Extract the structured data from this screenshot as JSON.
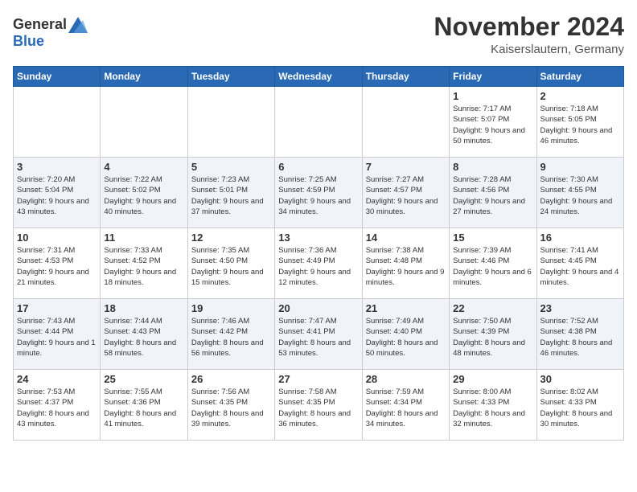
{
  "logo": {
    "general": "General",
    "blue": "Blue"
  },
  "title": "November 2024",
  "location": "Kaiserslautern, Germany",
  "weekdays": [
    "Sunday",
    "Monday",
    "Tuesday",
    "Wednesday",
    "Thursday",
    "Friday",
    "Saturday"
  ],
  "weeks": [
    [
      {
        "day": "",
        "sunrise": "",
        "sunset": "",
        "daylight": ""
      },
      {
        "day": "",
        "sunrise": "",
        "sunset": "",
        "daylight": ""
      },
      {
        "day": "",
        "sunrise": "",
        "sunset": "",
        "daylight": ""
      },
      {
        "day": "",
        "sunrise": "",
        "sunset": "",
        "daylight": ""
      },
      {
        "day": "",
        "sunrise": "",
        "sunset": "",
        "daylight": ""
      },
      {
        "day": "1",
        "sunrise": "Sunrise: 7:17 AM",
        "sunset": "Sunset: 5:07 PM",
        "daylight": "Daylight: 9 hours and 50 minutes."
      },
      {
        "day": "2",
        "sunrise": "Sunrise: 7:18 AM",
        "sunset": "Sunset: 5:05 PM",
        "daylight": "Daylight: 9 hours and 46 minutes."
      }
    ],
    [
      {
        "day": "3",
        "sunrise": "Sunrise: 7:20 AM",
        "sunset": "Sunset: 5:04 PM",
        "daylight": "Daylight: 9 hours and 43 minutes."
      },
      {
        "day": "4",
        "sunrise": "Sunrise: 7:22 AM",
        "sunset": "Sunset: 5:02 PM",
        "daylight": "Daylight: 9 hours and 40 minutes."
      },
      {
        "day": "5",
        "sunrise": "Sunrise: 7:23 AM",
        "sunset": "Sunset: 5:01 PM",
        "daylight": "Daylight: 9 hours and 37 minutes."
      },
      {
        "day": "6",
        "sunrise": "Sunrise: 7:25 AM",
        "sunset": "Sunset: 4:59 PM",
        "daylight": "Daylight: 9 hours and 34 minutes."
      },
      {
        "day": "7",
        "sunrise": "Sunrise: 7:27 AM",
        "sunset": "Sunset: 4:57 PM",
        "daylight": "Daylight: 9 hours and 30 minutes."
      },
      {
        "day": "8",
        "sunrise": "Sunrise: 7:28 AM",
        "sunset": "Sunset: 4:56 PM",
        "daylight": "Daylight: 9 hours and 27 minutes."
      },
      {
        "day": "9",
        "sunrise": "Sunrise: 7:30 AM",
        "sunset": "Sunset: 4:55 PM",
        "daylight": "Daylight: 9 hours and 24 minutes."
      }
    ],
    [
      {
        "day": "10",
        "sunrise": "Sunrise: 7:31 AM",
        "sunset": "Sunset: 4:53 PM",
        "daylight": "Daylight: 9 hours and 21 minutes."
      },
      {
        "day": "11",
        "sunrise": "Sunrise: 7:33 AM",
        "sunset": "Sunset: 4:52 PM",
        "daylight": "Daylight: 9 hours and 18 minutes."
      },
      {
        "day": "12",
        "sunrise": "Sunrise: 7:35 AM",
        "sunset": "Sunset: 4:50 PM",
        "daylight": "Daylight: 9 hours and 15 minutes."
      },
      {
        "day": "13",
        "sunrise": "Sunrise: 7:36 AM",
        "sunset": "Sunset: 4:49 PM",
        "daylight": "Daylight: 9 hours and 12 minutes."
      },
      {
        "day": "14",
        "sunrise": "Sunrise: 7:38 AM",
        "sunset": "Sunset: 4:48 PM",
        "daylight": "Daylight: 9 hours and 9 minutes."
      },
      {
        "day": "15",
        "sunrise": "Sunrise: 7:39 AM",
        "sunset": "Sunset: 4:46 PM",
        "daylight": "Daylight: 9 hours and 6 minutes."
      },
      {
        "day": "16",
        "sunrise": "Sunrise: 7:41 AM",
        "sunset": "Sunset: 4:45 PM",
        "daylight": "Daylight: 9 hours and 4 minutes."
      }
    ],
    [
      {
        "day": "17",
        "sunrise": "Sunrise: 7:43 AM",
        "sunset": "Sunset: 4:44 PM",
        "daylight": "Daylight: 9 hours and 1 minute."
      },
      {
        "day": "18",
        "sunrise": "Sunrise: 7:44 AM",
        "sunset": "Sunset: 4:43 PM",
        "daylight": "Daylight: 8 hours and 58 minutes."
      },
      {
        "day": "19",
        "sunrise": "Sunrise: 7:46 AM",
        "sunset": "Sunset: 4:42 PM",
        "daylight": "Daylight: 8 hours and 56 minutes."
      },
      {
        "day": "20",
        "sunrise": "Sunrise: 7:47 AM",
        "sunset": "Sunset: 4:41 PM",
        "daylight": "Daylight: 8 hours and 53 minutes."
      },
      {
        "day": "21",
        "sunrise": "Sunrise: 7:49 AM",
        "sunset": "Sunset: 4:40 PM",
        "daylight": "Daylight: 8 hours and 50 minutes."
      },
      {
        "day": "22",
        "sunrise": "Sunrise: 7:50 AM",
        "sunset": "Sunset: 4:39 PM",
        "daylight": "Daylight: 8 hours and 48 minutes."
      },
      {
        "day": "23",
        "sunrise": "Sunrise: 7:52 AM",
        "sunset": "Sunset: 4:38 PM",
        "daylight": "Daylight: 8 hours and 46 minutes."
      }
    ],
    [
      {
        "day": "24",
        "sunrise": "Sunrise: 7:53 AM",
        "sunset": "Sunset: 4:37 PM",
        "daylight": "Daylight: 8 hours and 43 minutes."
      },
      {
        "day": "25",
        "sunrise": "Sunrise: 7:55 AM",
        "sunset": "Sunset: 4:36 PM",
        "daylight": "Daylight: 8 hours and 41 minutes."
      },
      {
        "day": "26",
        "sunrise": "Sunrise: 7:56 AM",
        "sunset": "Sunset: 4:35 PM",
        "daylight": "Daylight: 8 hours and 39 minutes."
      },
      {
        "day": "27",
        "sunrise": "Sunrise: 7:58 AM",
        "sunset": "Sunset: 4:35 PM",
        "daylight": "Daylight: 8 hours and 36 minutes."
      },
      {
        "day": "28",
        "sunrise": "Sunrise: 7:59 AM",
        "sunset": "Sunset: 4:34 PM",
        "daylight": "Daylight: 8 hours and 34 minutes."
      },
      {
        "day": "29",
        "sunrise": "Sunrise: 8:00 AM",
        "sunset": "Sunset: 4:33 PM",
        "daylight": "Daylight: 8 hours and 32 minutes."
      },
      {
        "day": "30",
        "sunrise": "Sunrise: 8:02 AM",
        "sunset": "Sunset: 4:33 PM",
        "daylight": "Daylight: 8 hours and 30 minutes."
      }
    ]
  ]
}
